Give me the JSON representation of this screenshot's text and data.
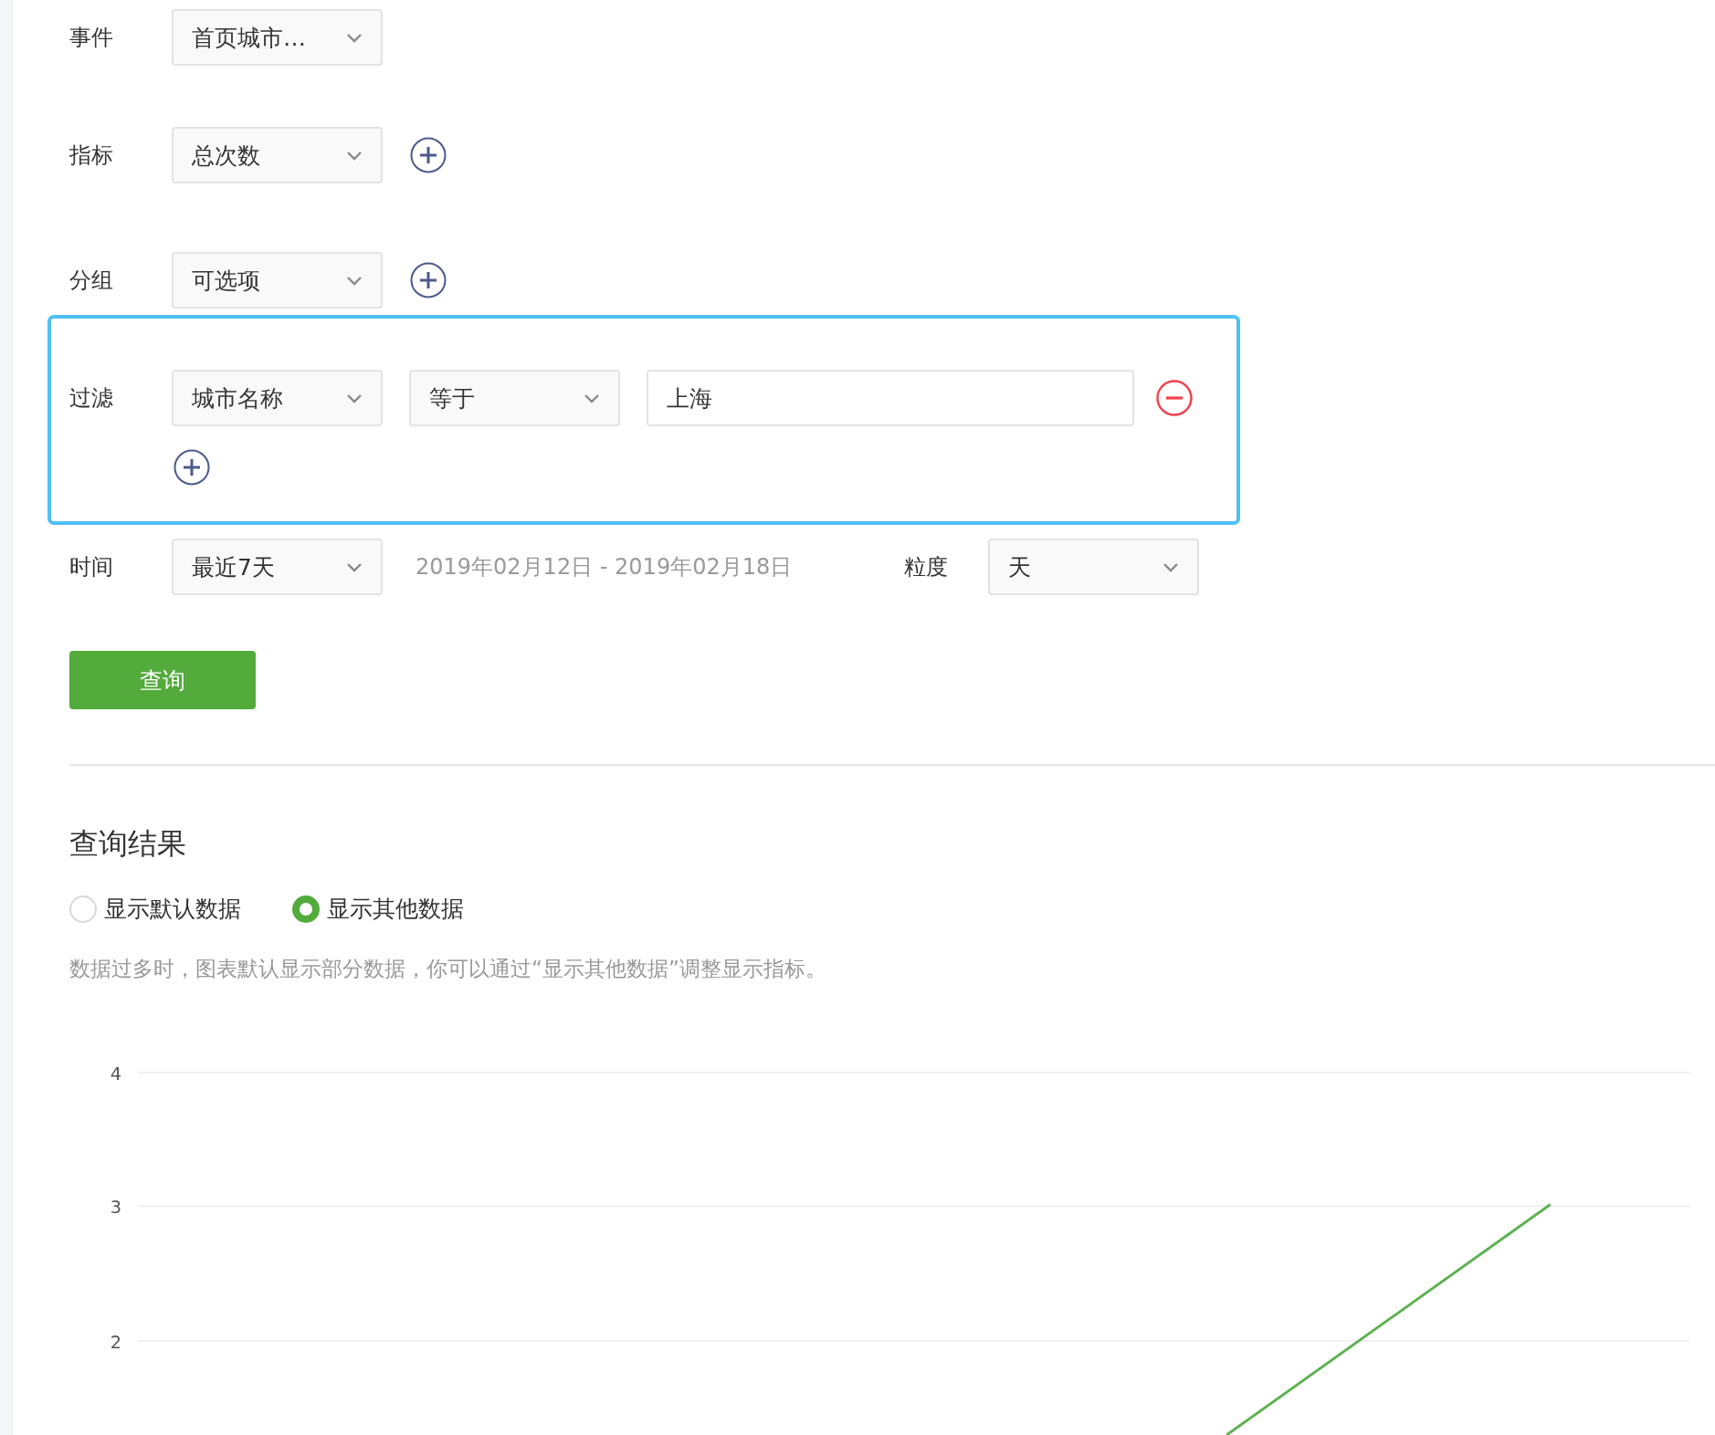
{
  "form": {
    "event": {
      "label": "事件",
      "value": "首页城市…"
    },
    "metric": {
      "label": "指标",
      "value": "总次数"
    },
    "group": {
      "label": "分组",
      "value": "可选项"
    },
    "filter": {
      "label": "过滤",
      "field": "城市名称",
      "operator": "等于",
      "value": "上海"
    },
    "time": {
      "label": "时间",
      "value": "最近7天",
      "range": "2019年02月12日 - 2019年02月18日",
      "granularity_label": "粒度",
      "granularity": "天"
    },
    "submit": "查询"
  },
  "results": {
    "title": "查询结果",
    "options": [
      {
        "label": "显示默认数据",
        "selected": false
      },
      {
        "label": "显示其他数据",
        "selected": true
      }
    ],
    "note": "数据过多时，图表默认显示部分数据，你可以通过“显示其他数据”调整显示指标。",
    "chart": {
      "y_ticks": [
        "4",
        "3",
        "2"
      ]
    }
  }
}
